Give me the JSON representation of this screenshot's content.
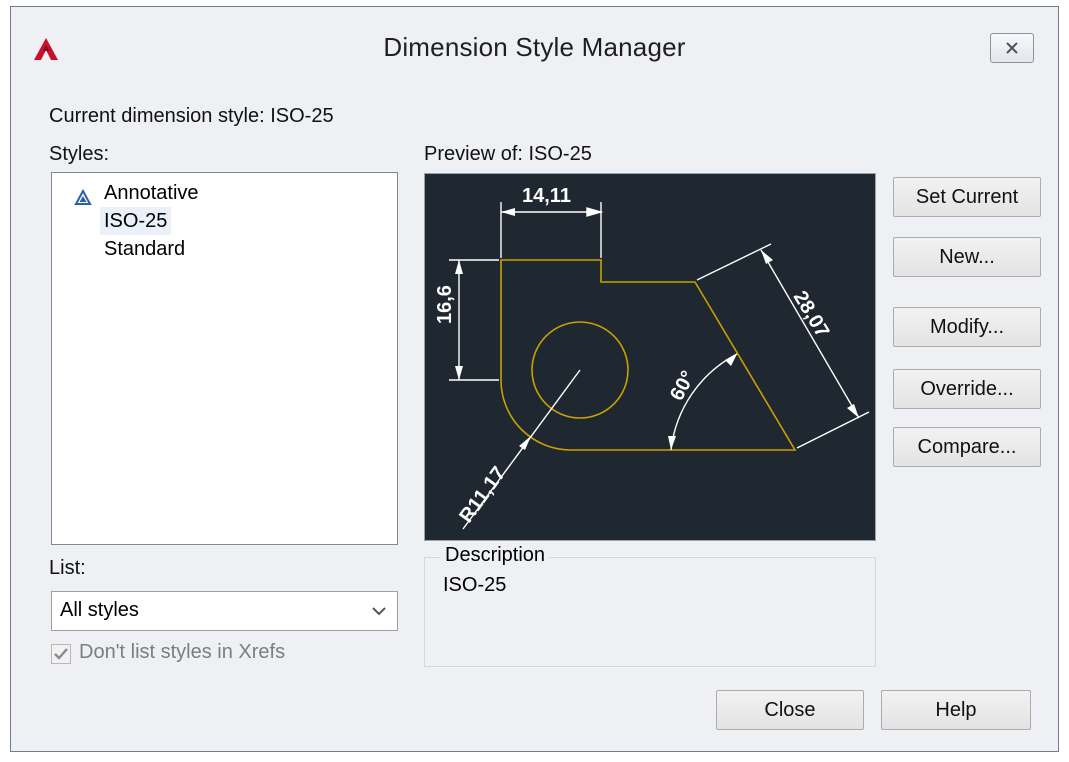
{
  "window": {
    "title": "Dimension Style Manager"
  },
  "current_style": {
    "label": "Current dimension style: ISO-25"
  },
  "styles": {
    "label": "Styles:",
    "items": [
      {
        "label": "Annotative"
      },
      {
        "label": "ISO-25"
      },
      {
        "label": "Standard"
      }
    ]
  },
  "list": {
    "label": "List:",
    "selected": "All styles",
    "xref_checkbox_label": "Don't list styles in Xrefs",
    "xref_checked": true
  },
  "preview": {
    "label": "Preview of: ISO-25",
    "dims": {
      "width": "14,11",
      "height": "16,6",
      "angle": "60°",
      "aligned": "28,07",
      "radius": "R11,17"
    }
  },
  "description": {
    "legend": "Description",
    "value": "ISO-25"
  },
  "buttons": {
    "set_current": "Set Current",
    "new": "New...",
    "modify": "Modify...",
    "override": "Override...",
    "compare": "Compare...",
    "close": "Close",
    "help": "Help"
  },
  "colors": {
    "preview_bg": "#1f2730",
    "geometry": "#c8a000",
    "dimension": "#ffffff",
    "brand_red": "#c8102e"
  },
  "icons": {
    "app": "autocad-a-icon",
    "annotative": "annotative-scale-icon",
    "close": "close-x-icon",
    "dropdown": "chevron-down-icon",
    "check": "checkmark-icon"
  }
}
